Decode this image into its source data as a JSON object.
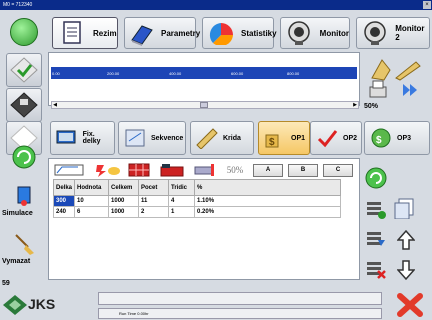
{
  "window": {
    "title": "M0 = 712340"
  },
  "toolbar": [
    {
      "label": "Rezim",
      "icon": "document-icon"
    },
    {
      "label": "Parametry",
      "icon": "book-icon"
    },
    {
      "label": "Statistiky",
      "icon": "pie-chart-icon"
    },
    {
      "label": "Monitor",
      "icon": "camera-icon"
    },
    {
      "label": "Monitor 2",
      "icon": "camera-icon"
    }
  ],
  "left": {
    "simulace": "Simulace",
    "vymazat": "Vymazat",
    "count": "59"
  },
  "ruler": {
    "marks": [
      "0.00",
      "200.00",
      "400.00",
      "600.00",
      "800.00"
    ]
  },
  "zoom": "50%",
  "tabs": [
    {
      "label": "Fix. delky"
    },
    {
      "label": "Sekvence"
    },
    {
      "label": "Krida"
    },
    {
      "label": "OP1"
    },
    {
      "label": "OP2"
    },
    {
      "label": "OP3"
    }
  ],
  "tools": {
    "percent": "50%",
    "a": "A",
    "b": "B",
    "c": "C"
  },
  "table": {
    "headers": [
      "Delka",
      "Hodnota",
      "Celkem",
      "Pocet",
      "Tridic",
      "%"
    ],
    "rows": [
      [
        "300",
        "10",
        "1000",
        "11",
        "4",
        "1.10%"
      ],
      [
        "240",
        "6",
        "1000",
        "2",
        "1",
        "0.20%"
      ]
    ]
  },
  "footer": {
    "logo": "JKS",
    "status": "Run Time 0.00hr"
  },
  "colors": {
    "titlebar": "#0a2b8a",
    "ruler": "#1d45b6",
    "selection": "#1b49b8",
    "close": "#e23a2a"
  }
}
